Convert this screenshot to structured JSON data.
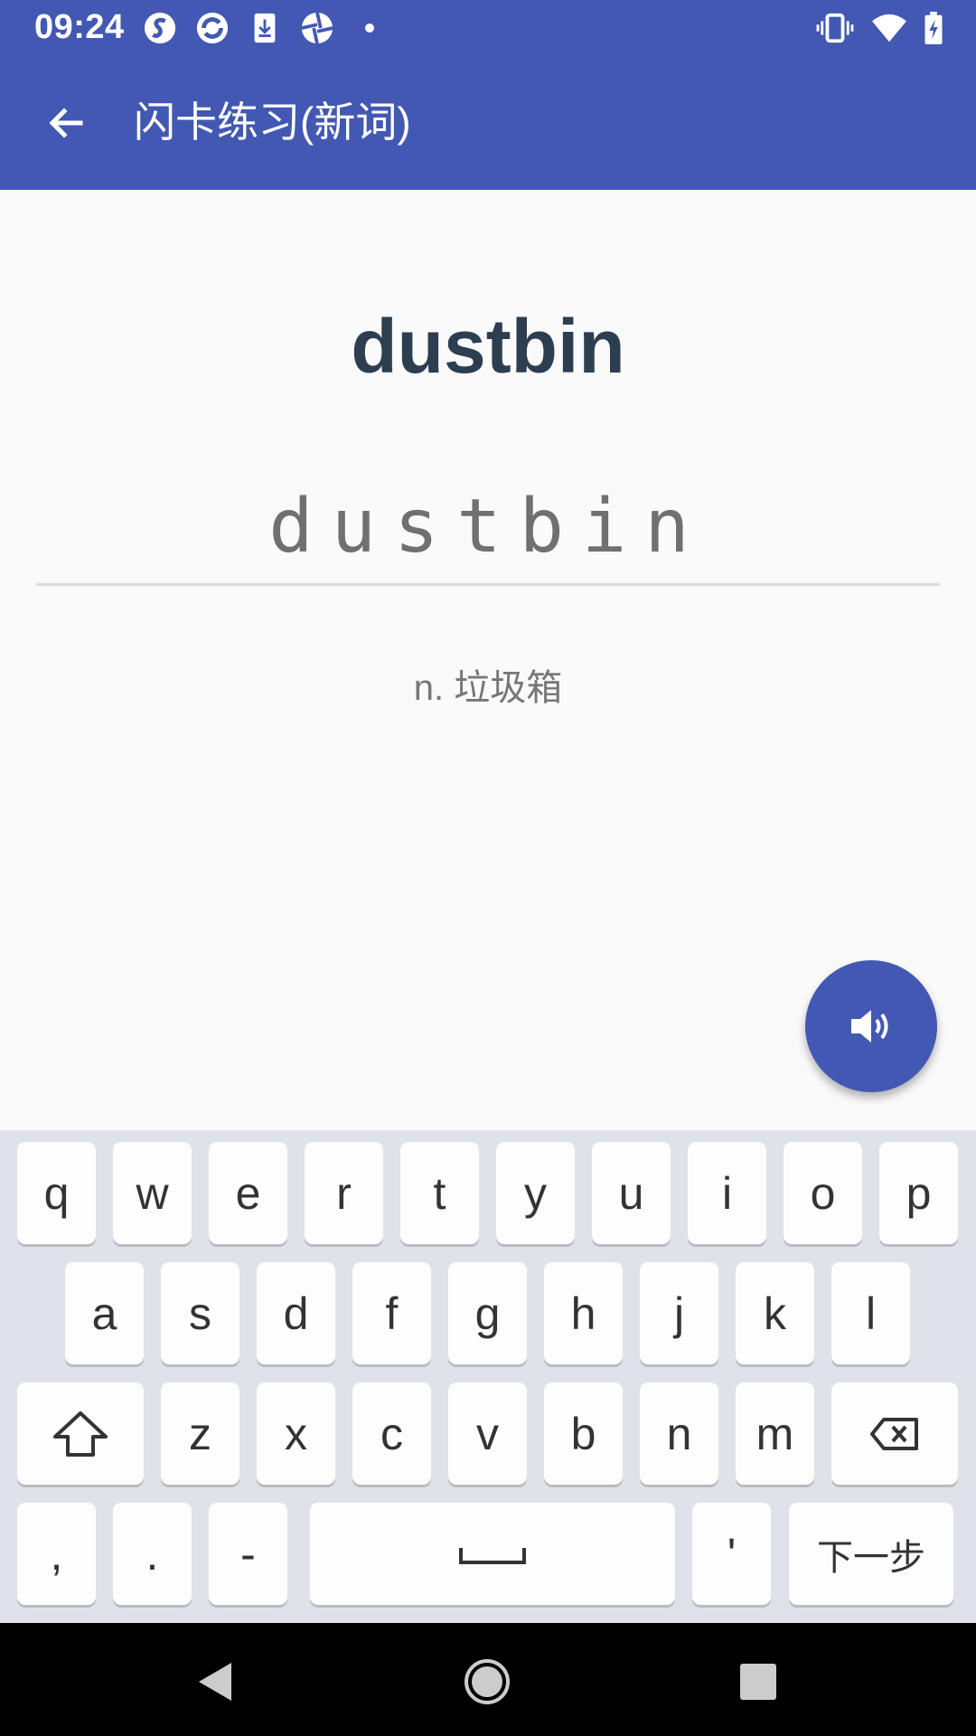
{
  "status_bar": {
    "time": "09:24",
    "icons": [
      "sogou-icon",
      "sync-icon",
      "download-icon",
      "aperture-icon",
      "notification-dot",
      "vibrate-icon",
      "wifi-icon",
      "battery-charging-icon"
    ]
  },
  "app_bar": {
    "back_icon": "arrow-back-icon",
    "title": "闪卡练习(新词)"
  },
  "card": {
    "word": "dustbin",
    "input_value": "dustbin",
    "definition": "n. 垃圾箱"
  },
  "fab": {
    "icon": "speaker-icon"
  },
  "keyboard": {
    "row1": [
      "q",
      "w",
      "e",
      "r",
      "t",
      "y",
      "u",
      "i",
      "o",
      "p"
    ],
    "row2": [
      "a",
      "s",
      "d",
      "f",
      "g",
      "h",
      "j",
      "k",
      "l"
    ],
    "row3": [
      "z",
      "x",
      "c",
      "v",
      "b",
      "n",
      "m"
    ],
    "row4": {
      "comma": ",",
      "period": ".",
      "dash": "-",
      "apostrophe": "'",
      "next_label": "下一步"
    }
  },
  "colors": {
    "primary": "#4258b3",
    "word": "#2c3e50",
    "background": "#fafafa",
    "keyboard": "#dfe2e8"
  }
}
